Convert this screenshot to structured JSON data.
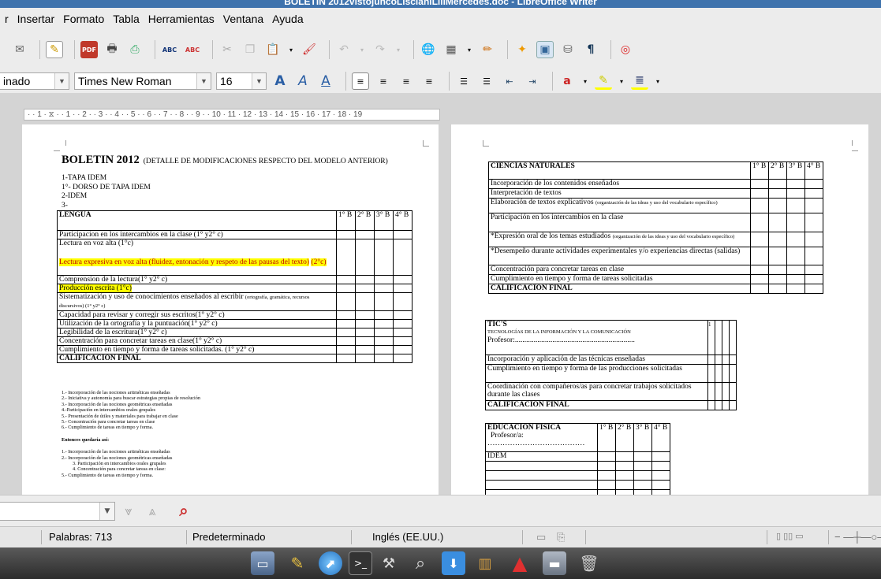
{
  "window": {
    "title": "BOLETIN 2012vistojuncoLiscianiLiliMercedes.doc - LibreOffice Writer"
  },
  "menu": {
    "items": [
      "r",
      "Insertar",
      "Formato",
      "Tabla",
      "Herramientas",
      "Ventana",
      "Ayuda"
    ]
  },
  "format": {
    "style": "inado",
    "font": "Times New Roman",
    "size": "16"
  },
  "ruler": {
    "marks": "· · 1 · ⧖ · · 1 · · 2 · · 3 · · 4 · · 5 · · 6 · · 7 · · 8 · · 9 · · 10 · 11 · 12 · 13 · 14 · 15 · 16 · 17 · 18 · 19"
  },
  "doc": {
    "title": "BOLETIN 2012",
    "subtitle": "(DETALLE DE MODIFICACIONES RESPECTO DEL MODELO ANTERIOR)",
    "list": [
      "1-TAPA  IDEM",
      "1°- DORSO DE TAPA IDEM",
      "2-IDEM",
      "3-"
    ],
    "cols": [
      "1° B",
      "2° B",
      "3° B",
      "4° B"
    ],
    "lengua": {
      "header": "LENGUA",
      "r1": "Participacion en los intercambios en la clase (1° y2° c)",
      "r2": "Lectura en voz alta (1°c)",
      "r3": "Lectura expresiva en voz alta (fluidez, entonación y respeto de las pausas del texto)",
      "r3b": "(2°c)",
      "r4": "Comprension de la lectura(1° y2° c)",
      "r5": "Producción escrita (1°c)",
      "r6": "Sistematización y uso de conocimientos enseñados al escribir",
      "r6b": "(ortografía, gramática, recursos discursivos) (1° y2° c)",
      "r7": "Capacidad para revisar y corregir sus escritos(1° y2° c)",
      "r8": "Utilización de la ortografía y la puntuación(1° y2° c)",
      "r9": "Legibilidad de la escritura(1° y2° c)",
      "r10": "Concentración para concretar tareas en clase(1° y2° c)",
      "r11": "Cumplimiento en tiempo y forma de tareas solicitadas. (1° y2° c)",
      "r12": "CALIFICACIÓN FINAL"
    },
    "notes": [
      "1.- Incorporación de las nociones aritméticas enseñadas",
      "2.- Iniciativa y autonomía para buscar estrategias propias de resolución",
      "3.- Incorporación de las nociones geométricas enseñadas",
      "4.-Participación en intercambios orales grupales",
      "5.- Presentación de útiles y materiales para trabajar en clase",
      "5.- Concentración para concretar tareas en clase",
      "6.- Cumplimiento de tareas en tiempo y forma."
    ],
    "notes_head": "Entonces quedaría así:",
    "notes2": [
      "1.- Incorporación de las nociones aritméticas enseñadas",
      "2.- Incorporación de las nociones geométricas enseñadas",
      "3.     Participación en intercambios orales grupales",
      "4.     Concentración para concretar tareas en clase:",
      "5.- Cumplimiento de tareas en tiempo y forma."
    ],
    "cn": {
      "header": "CIENCIAS NATURALES",
      "r1": "Incorporación de los contenidos enseñados",
      "r2": "Interpretación de textos",
      "r3": "Elaboración de textos explicativos",
      "r3b": "(organización de las ideas y uso del vocabulario específico)",
      "r4": "Participación en los intercambios en la clase",
      "r5": "*Expresión oral de los temas estudiados",
      "r5b": "(organización de las ideas y uso del vocabulario específico)",
      "r6": "*Desempeño durante actividades experimentales y/o experiencias directas (salidas)",
      "r7": "Concentración para concretar tareas en clase",
      "r8": "Cumplimiento en tiempo y forma de tareas solicitadas",
      "r9": "CALIFICACIÓN FINAL"
    },
    "tic": {
      "header": "TIC'S",
      "sub": "TECNOLOGÍAS DE LA INFORMACIÓN Y LA COMUNICACIÓN",
      "prof": "Profesor:................................................................",
      "col1": "1",
      "r1": "Incorporación y aplicación de las técnicas enseñadas",
      "r2": "Cumplimiento en tiempo y forma de las producciones solicitadas",
      "r3": "Coordinación con compañeros/as para concretar trabajos solicitados durante las clases",
      "r4": "CALIFICACIÓN FINAL"
    },
    "ef": {
      "header": "EDUCACIÓN FÍSICA",
      "prof": "Profesor/a:",
      "dots": "…………………………………",
      "r1": "IDEM"
    }
  },
  "status": {
    "words": "Palabras: 713",
    "style": "Predeterminado",
    "lang": "Inglés (EE.UU.)"
  }
}
